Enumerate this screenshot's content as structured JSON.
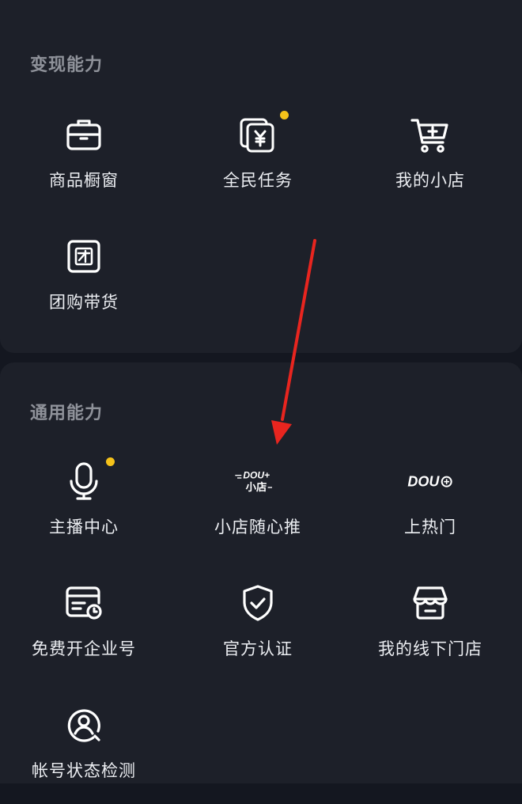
{
  "colors": {
    "background": "#141720",
    "card": "#1d2029",
    "section_title": "#8f929a",
    "label": "#eceef2",
    "badge_dot": "#f5c21a",
    "arrow": "#e8251f"
  },
  "sections": [
    {
      "title": "变现能力",
      "items": [
        {
          "label": "商品橱窗",
          "icon": "briefcase-icon"
        },
        {
          "label": "全民任务",
          "icon": "yuan-cards-icon",
          "badge": true
        },
        {
          "label": "我的小店",
          "icon": "cart-icon"
        },
        {
          "label": "团购带货",
          "icon": "group-buy-icon"
        }
      ]
    },
    {
      "title": "通用能力",
      "items": [
        {
          "label": "主播中心",
          "icon": "microphone-icon",
          "badge": true
        },
        {
          "label": "小店随心推",
          "icon": "dou-plus-shop-logo",
          "logo_top": "DOU+",
          "logo_bottom": "小店"
        },
        {
          "label": "上热门",
          "icon": "dou-plus-logo",
          "logo_text": "DOU"
        },
        {
          "label": "免费开企业号",
          "icon": "enterprise-card-icon"
        },
        {
          "label": "官方认证",
          "icon": "shield-check-icon"
        },
        {
          "label": "我的线下门店",
          "icon": "store-icon"
        },
        {
          "label": "帐号状态检测",
          "icon": "account-check-icon"
        }
      ]
    }
  ]
}
